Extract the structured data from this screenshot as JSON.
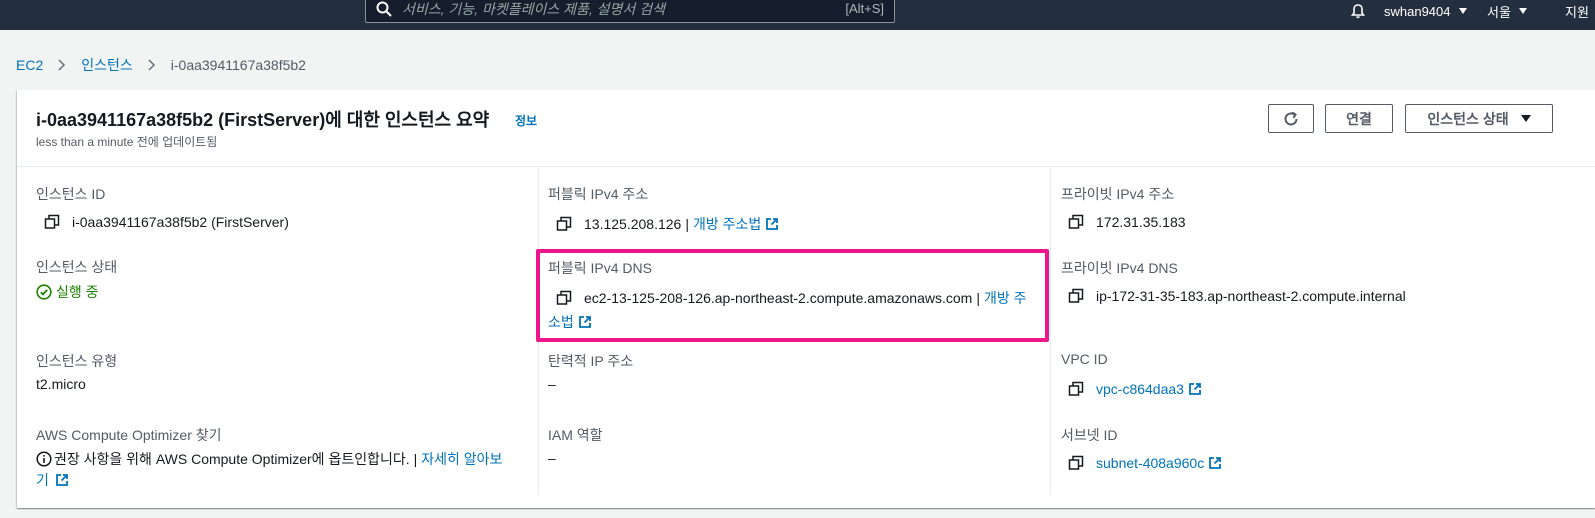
{
  "topbar": {
    "search_placeholder": "서비스, 기능, 마켓플레이스 제품, 설명서 검색",
    "search_shortcut": "[Alt+S]",
    "user": "swhan9404",
    "region": "서울",
    "support_partial": "지원"
  },
  "breadcrumb": {
    "items": [
      "EC2",
      "인스턴스"
    ],
    "current": "i-0aa3941167a38f5b2"
  },
  "summary": {
    "title": "i-0aa3941167a38f5b2 (FirstServer)에 대한 인스턴스 요약",
    "info": "정보",
    "updated": "less than a minute 전에 업데이트됨",
    "connect_label": "연결",
    "state_label": "인스턴스 상태"
  },
  "fields": {
    "instance_id_label": "인스턴스 ID",
    "instance_id": "i-0aa3941167a38f5b2 (FirstServer)",
    "public_ip_label": "퍼블릭 IPv4 주소",
    "public_ip": "13.125.208.126",
    "open_address": "개방 주소법",
    "private_ip_label": "프라이빗 IPv4 주소",
    "private_ip": "172.31.35.183",
    "state_label": "인스턴스 상태",
    "state": "실행 중",
    "public_dns_label": "퍼블릭 IPv4 DNS",
    "public_dns": "ec2-13-125-208-126.ap-northeast-2.compute.amazonaws.com",
    "open_address_part1": "개방 주",
    "open_address_part2": "소법",
    "private_dns_label": "프라이빗 IPv4 DNS",
    "private_dns": "ip-172-31-35-183.ap-northeast-2.compute.internal",
    "type_label": "인스턴스 유형",
    "type": "t2.micro",
    "eip_label": "탄력적 IP 주소",
    "eip": "–",
    "vpc_label": "VPC ID",
    "vpc": "vpc-c864daa3",
    "optimizer_label": "AWS Compute Optimizer 찾기",
    "optimizer_text": "권장 사항을 위해 AWS Compute Optimizer에 옵트인합니다.",
    "learn_more_part1": "자세히 알아보",
    "learn_more_part2": "기",
    "iam_label": "IAM 역할",
    "iam": "–",
    "subnet_label": "서브넷 ID",
    "subnet": "subnet-408a960c"
  },
  "colors": {
    "highlight": "#ec178d",
    "link": "#0073bb",
    "running": "#1d8102"
  }
}
